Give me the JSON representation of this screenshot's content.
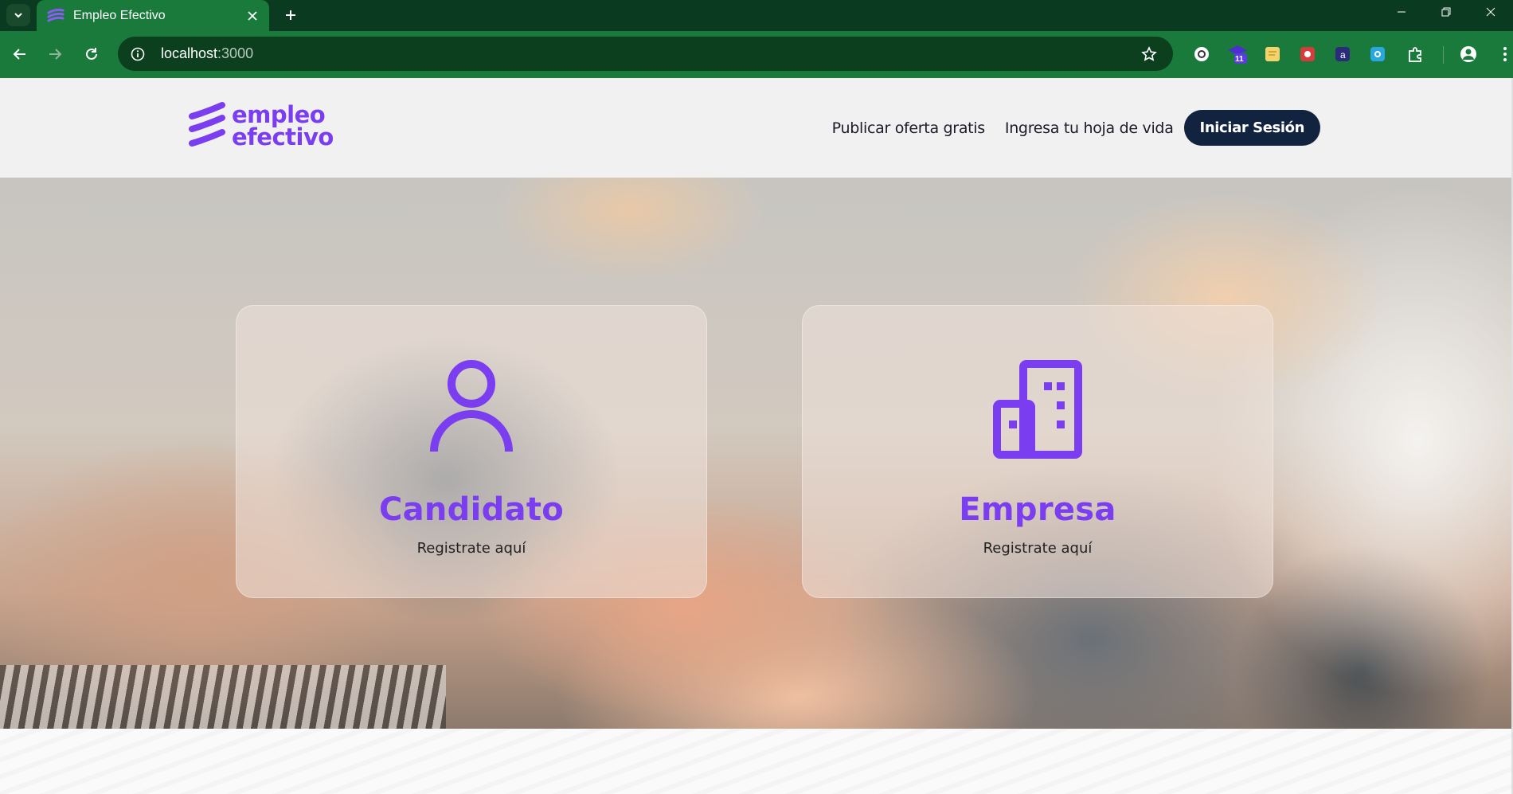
{
  "browser": {
    "tab_title": "Empleo Efectivo",
    "url_host": "localhost",
    "url_port": ":3000",
    "extension_badge": "11"
  },
  "site": {
    "logo_line1": "empleo",
    "logo_line2": "efectivo",
    "nav": {
      "publish": "Publicar oferta gratis",
      "cv": "Ingresa tu hoja de vida",
      "login": "Iniciar Sesión"
    }
  },
  "cards": {
    "candidate": {
      "title": "Candidato",
      "subtitle": "Registrate aquí",
      "icon": "person-icon"
    },
    "company": {
      "title": "Empresa",
      "subtitle": "Registrate aquí",
      "icon": "building-icon"
    }
  },
  "colors": {
    "brand": "#7a3df0",
    "chrome": "#1a7a3c",
    "login_button": "#12233f"
  }
}
